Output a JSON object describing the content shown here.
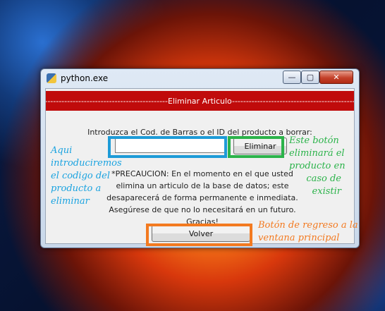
{
  "window": {
    "title": "python.exe",
    "buttons": {
      "minimize": "—",
      "maximize": "▢",
      "close": "✕"
    }
  },
  "banner": {
    "text": "----------------------------------------------------------Eliminar Articulo----------------------------------------------------------"
  },
  "form": {
    "prompt": "Introduzca el Cod. de Barras o el ID del producto a borrar:",
    "code_value": "",
    "delete_label": "Eliminar",
    "warning": "*PRECAUCION: En el momento en el que usted elimina un articulo de la base de datos; este desaparecerá de forma permanente e inmediata. Asegúrese de que no lo necesitará en un futuro. Gracias!",
    "back_label": "Volver"
  },
  "annotations": {
    "input_note": "Aqui introduciremos el codigo del producto a eliminar",
    "delete_note_lines": [
      "Este botón",
      "eliminará el",
      "producto en",
      "caso de",
      "existir"
    ],
    "back_note": "Botón de regreso a la ventana principal"
  },
  "colors": {
    "banner": "#c00b0b",
    "annotation_blue": "#1aa3e0",
    "annotation_green": "#2bb34a",
    "annotation_orange": "#f37a20"
  }
}
